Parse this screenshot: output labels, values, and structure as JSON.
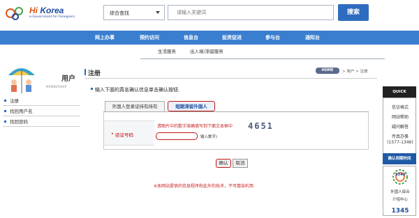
{
  "logo": {
    "brand_hi": "Hi",
    "brand_rest": " Korea",
    "tagline": "e-Government for Foreigners"
  },
  "search": {
    "category": "综合查找",
    "placeholder": "请输入关键词",
    "button": "搜索"
  },
  "nav": {
    "items": [
      "网上办事",
      "预约访问",
      "信息台",
      "投资促进",
      "参与台",
      "通知台"
    ],
    "sub_items": [
      "生活服务",
      "出入境/滞留服务"
    ]
  },
  "sidebar": {
    "title": "用户",
    "subtitle": "MEMBERSHIP",
    "items": [
      "注册",
      "找回用户名",
      "找回密码"
    ]
  },
  "main": {
    "title": "注册",
    "home_badge": "HOME",
    "breadcrumb": "> 用户 > 注册",
    "instruction": "输入下面的真名确认信息单击确认按钮.",
    "tabs": [
      "外国人登录证持有持有",
      "短期滞留外国人"
    ],
    "active_tab": 1,
    "form": {
      "label": "验证号码",
      "hint": "请图片中的数字准确填写到下面文本框中",
      "captcha": "4651",
      "input_value": "",
      "input_note": "输入数字)"
    },
    "confirm_button": "确认",
    "cancel_button": "取消",
    "footnote": "※本网站提供的信息程序和此外的技术，不可擅自利用"
  },
  "quick": {
    "head": "QUICK",
    "items": [
      "信访格式",
      "网站帮助",
      "疑问解答",
      "传真办事",
      "(1577-1346)"
    ],
    "foot": "确认到期时间"
  },
  "center": {
    "logo_number": "1345",
    "line1": "外国人綜合",
    "line2": "介绍中心",
    "number": "1345"
  },
  "colors": {
    "brand_blue": "#3a7ed0",
    "alert_red": "#c01515",
    "dark": "#222222"
  }
}
